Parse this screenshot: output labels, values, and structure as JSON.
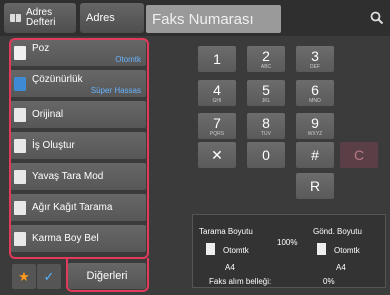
{
  "topbar": {
    "address_book_label": "Adres\nDefteri",
    "address_label": "Adres",
    "fax_placeholder": "Faks Numarası"
  },
  "menu": {
    "items": [
      {
        "label": "Poz",
        "sub": "Otomtk",
        "icon": "exposure-icon"
      },
      {
        "label": "Çözünürlük",
        "sub": "Süper Hassas",
        "icon": "resolution-icon"
      },
      {
        "label": "Orijinal",
        "sub": "",
        "icon": "original-icon"
      },
      {
        "label": "İş Oluştur",
        "sub": "",
        "icon": "job-build-icon"
      },
      {
        "label": "Yavaş Tara Mod",
        "sub": "",
        "icon": "slow-scan-icon"
      },
      {
        "label": "Ağır Kağıt Tarama",
        "sub": "",
        "icon": "heavy-paper-icon"
      },
      {
        "label": "Karma Boy Bel",
        "sub": "",
        "icon": "mixed-size-icon"
      }
    ],
    "other_label": "Diğerleri"
  },
  "keypad": {
    "keys": [
      {
        "digit": "1",
        "letters": ""
      },
      {
        "digit": "2",
        "letters": "ABC"
      },
      {
        "digit": "3",
        "letters": "DEF"
      },
      {
        "digit": "4",
        "letters": "GHI"
      },
      {
        "digit": "5",
        "letters": "JKL"
      },
      {
        "digit": "6",
        "letters": "MNO"
      },
      {
        "digit": "7",
        "letters": "PQRS"
      },
      {
        "digit": "8",
        "letters": "TUV"
      },
      {
        "digit": "9",
        "letters": "WXYZ"
      }
    ],
    "pause": "✕",
    "zero": "0",
    "hash": "#",
    "clear": "C",
    "redial": "R"
  },
  "status": {
    "scan_size_label": "Tarama Boyutu",
    "send_size_label": "Gönd. Boyutu",
    "scan_mode": "Otomtk",
    "send_mode": "Otomtk",
    "ratio": "100%",
    "scan_paper": "A4",
    "send_paper": "A4",
    "memory_label": "Faks alım belleği:",
    "memory_value": "0%"
  },
  "colors": {
    "frame": "#e23a5a",
    "sub_label": "#66b3ff",
    "star": "#ff9a1f"
  }
}
